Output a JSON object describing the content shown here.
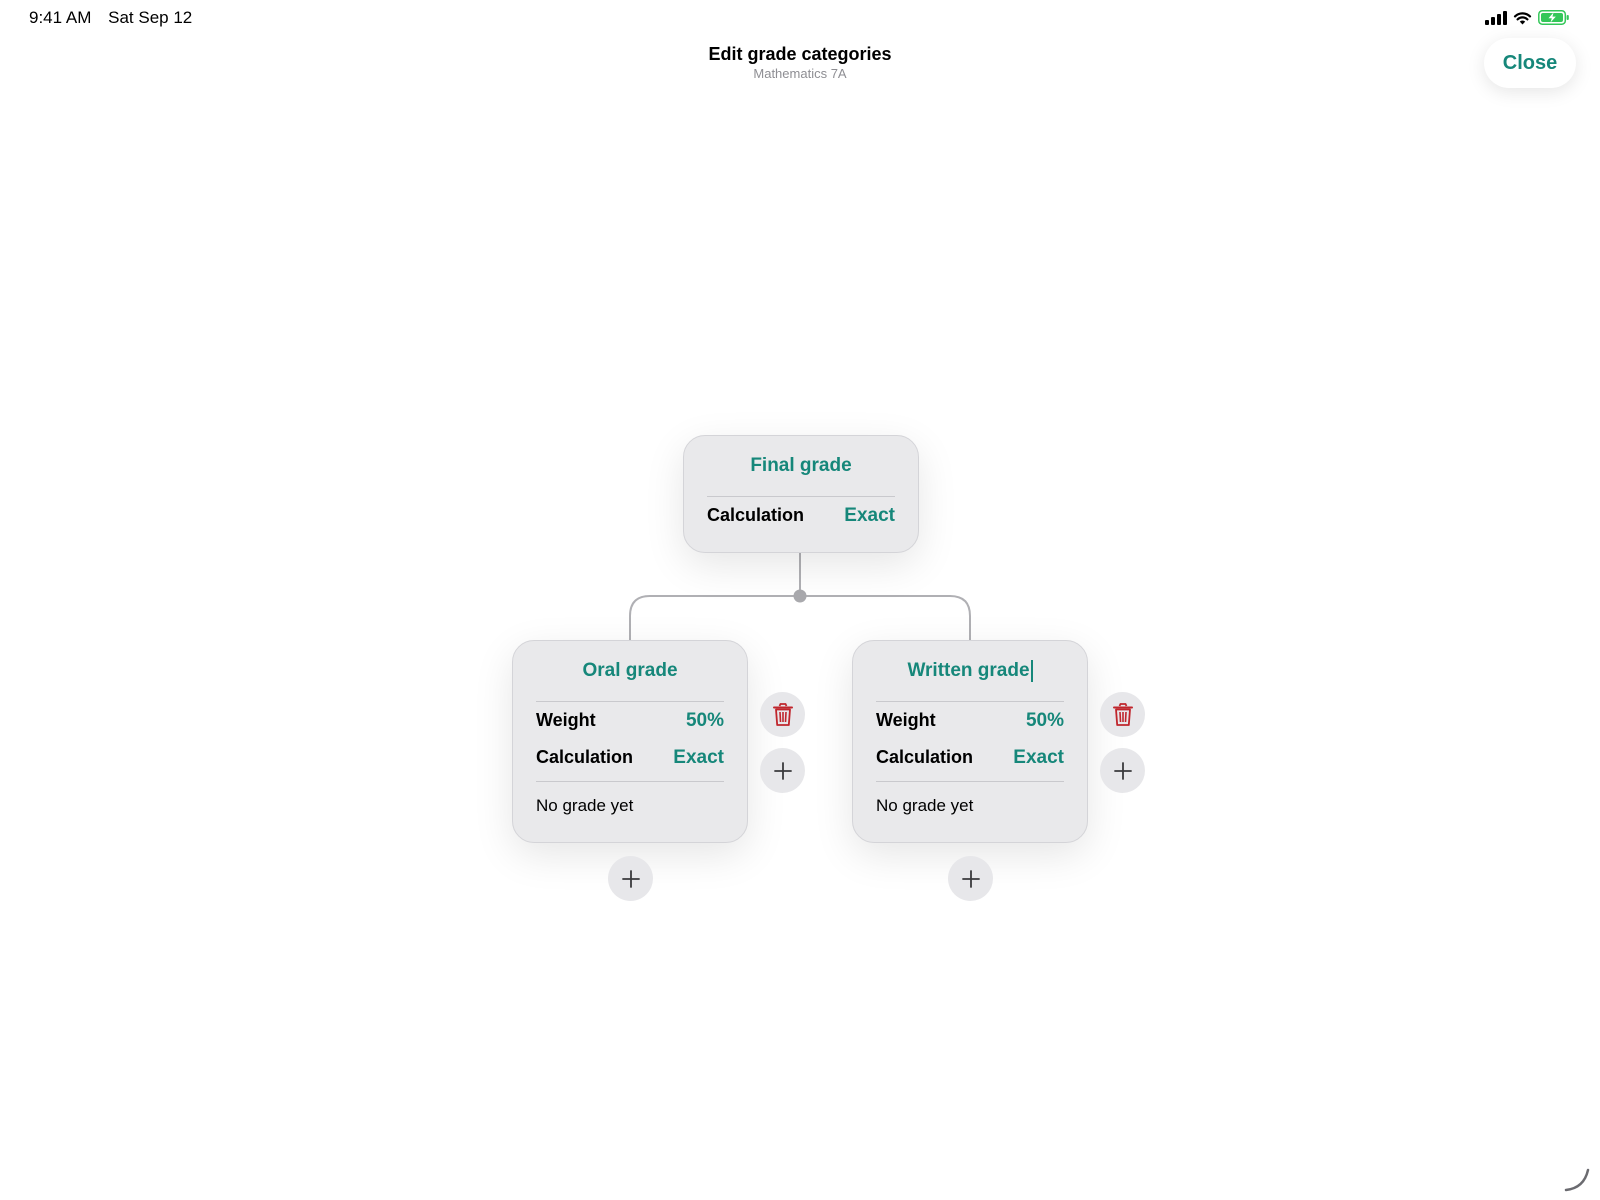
{
  "status_bar": {
    "time": "9:41 AM",
    "date": "Sat Sep 12",
    "icons": [
      "cellular-signal-icon",
      "wifi-icon",
      "battery-charging-icon"
    ]
  },
  "header": {
    "title": "Edit grade categories",
    "subtitle": "Mathematics 7A",
    "close_label": "Close"
  },
  "tree": {
    "root": {
      "title": "Final grade",
      "calculation_label": "Calculation",
      "calculation_value": "Exact"
    },
    "children": [
      {
        "title": "Oral grade",
        "weight_label": "Weight",
        "weight_value": "50%",
        "calculation_label": "Calculation",
        "calculation_value": "Exact",
        "grade_status": "No grade yet"
      },
      {
        "title": "Written grade",
        "weight_label": "Weight",
        "weight_value": "50%",
        "calculation_label": "Calculation",
        "calculation_value": "Exact",
        "grade_status": "No grade yet",
        "editing": true
      }
    ]
  },
  "colors": {
    "accent": "#16877a",
    "delete": "#c0262d",
    "card_background": "#e9e9eb",
    "connector": "#b0b0b4"
  }
}
